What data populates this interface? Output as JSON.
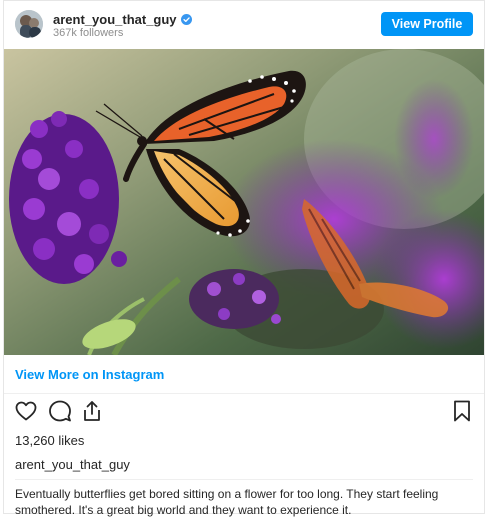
{
  "header": {
    "username": "arent_you_that_guy",
    "followers": "367k followers",
    "view_profile_label": "View Profile",
    "verified_icon": "verified-badge-icon"
  },
  "post": {
    "image_alt": "Monarch butterfly on purple flowers",
    "view_more_label": "View More on Instagram",
    "icons": [
      "heart-icon",
      "comment-icon",
      "share-icon",
      "bookmark-icon"
    ],
    "likes": "13,260 likes",
    "caption_username": "arent_you_that_guy",
    "caption_text": "Eventually butterflies get bored sitting on a flower for too long. They start feeling smothered. It's a great big world and they want to experience it."
  },
  "colors": {
    "accent": "#0095f6",
    "text": "#262626",
    "muted": "#8e8e8e"
  }
}
